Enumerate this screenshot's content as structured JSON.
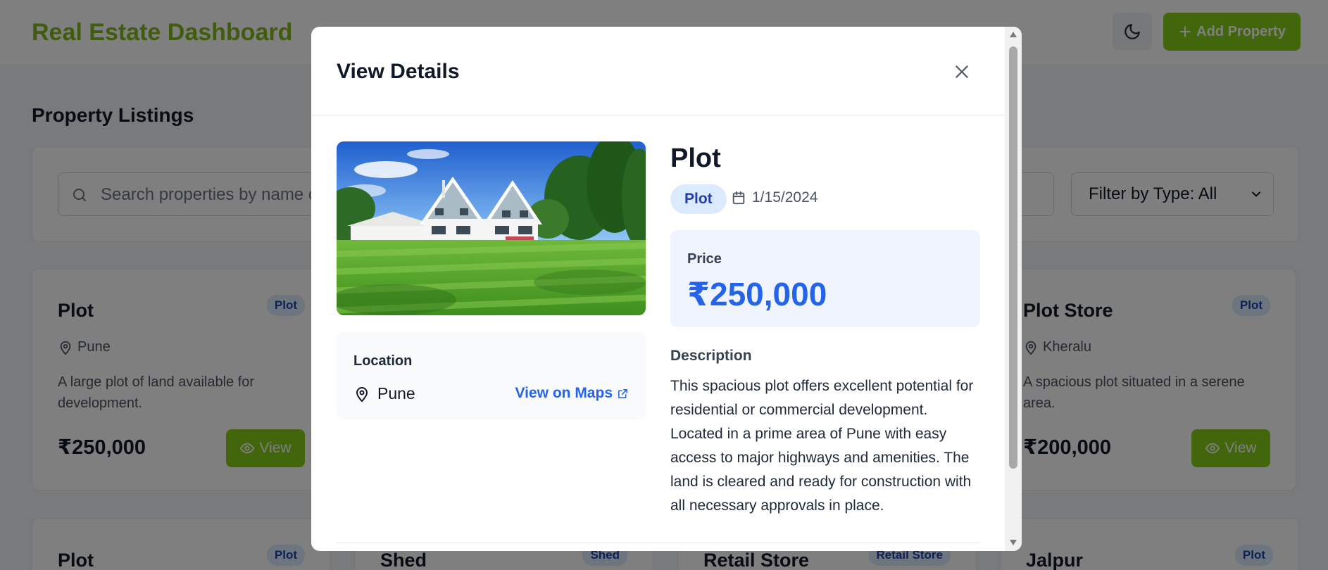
{
  "header": {
    "title": "Real Estate Dashboard",
    "add_label": "Add Property"
  },
  "section_title": "Property Listings",
  "search": {
    "placeholder": "Search properties by name or location...",
    "filter_label": "Filter by Type: All"
  },
  "cards": [
    {
      "title": "Plot",
      "badge": "Plot",
      "location": "Pune",
      "description": "A large plot of land available for development.",
      "price": "₹250,000",
      "view_label": "View"
    },
    {
      "title": "Plot Store",
      "badge": "Plot",
      "location": "Kheralu",
      "description": "A spacious plot situated in a serene area.",
      "price": "₹200,000",
      "view_label": "View"
    }
  ],
  "cards_row2": [
    {
      "title": "Plot",
      "badge": "Plot"
    },
    {
      "title": "Shed",
      "badge": "Shed"
    },
    {
      "title": "Retail Store",
      "badge": "Retail Store"
    },
    {
      "title": "Jalpur",
      "badge": "Plot"
    }
  ],
  "modal": {
    "title": "View Details",
    "property_title": "Plot",
    "type_badge": "Plot",
    "date": "1/15/2024",
    "price_label": "Price",
    "price": "₹250,000",
    "location_label": "Location",
    "location": "Pune",
    "maps_label": "View on Maps",
    "description_label": "Description",
    "description": "This spacious plot offers excellent potential for residential or commercial development. Located in a prime area of Pune with easy access to major highways and amenities. The land is cleared and ready for construction with all necessary approvals in place."
  },
  "colors": {
    "accent": "#84cc16",
    "brand_title": "#84b81f",
    "link": "#2563eb",
    "badge_bg": "#dbeafe",
    "badge_text": "#1e40af"
  }
}
